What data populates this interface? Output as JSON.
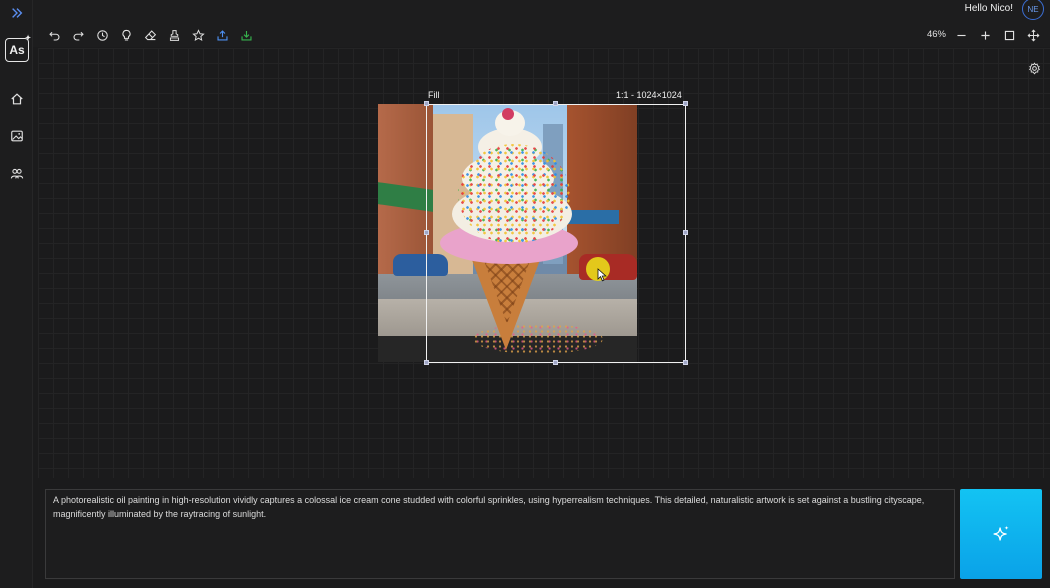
{
  "app": {
    "logo_text": "As",
    "greeting": "Hello Nico!",
    "avatar_initials": "NE"
  },
  "sidebar": {
    "items": [
      {
        "icon": "expand-chevrons-icon"
      },
      {
        "icon": "home-icon"
      },
      {
        "icon": "image-icon"
      },
      {
        "icon": "community-icon"
      }
    ]
  },
  "toolbar": {
    "tools": [
      "undo-icon",
      "redo-icon",
      "history-icon",
      "lightbulb-icon",
      "eraser-icon",
      "stamp-icon",
      "star-icon",
      "upload-icon",
      "download-icon"
    ],
    "zoom_level": "46%"
  },
  "canvas": {
    "selection_mode": "Fill",
    "selection_ratio": "1:1 - 1024×1024"
  },
  "prompt": {
    "text": "A photorealistic oil painting in high-resolution vividly captures a colossal ice cream cone studded with colorful sprinkles, using hyperrealism techniques. This detailed, naturalistic artwork is set against a bustling cityscape, magnificently illuminated by the raytracing of sunlight."
  },
  "colors": {
    "background": "#1b1b1c",
    "generate_button": "#0aa2e8",
    "accent_blue": "#3b6fd6",
    "download_green": "#37b24d",
    "cursor_highlight": "#e8d61a"
  }
}
